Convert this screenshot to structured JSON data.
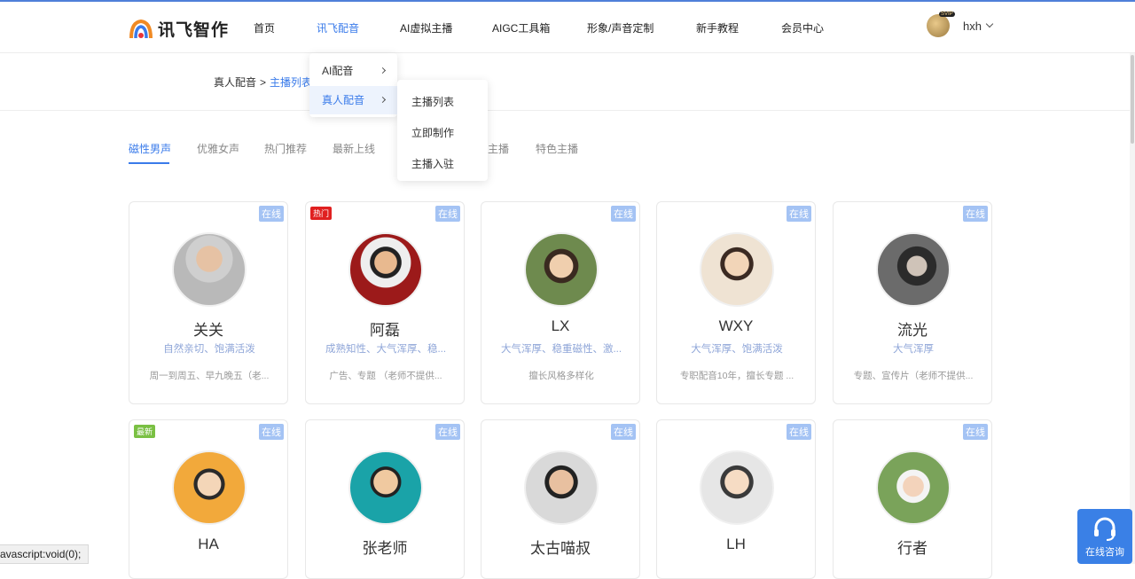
{
  "header": {
    "logo_text": "讯飞智作",
    "nav": [
      "首页",
      "讯飞配音",
      "AI虚拟主播",
      "AIGC工具箱",
      "形象/声音定制",
      "新手教程",
      "会员中心"
    ],
    "user": {
      "name": "hxh",
      "badge": "SVIP"
    }
  },
  "breadcrumb": {
    "root": "真人配音",
    "separator": ">",
    "current": "主播列表"
  },
  "dropdown": {
    "level1": [
      {
        "label": "AI配音"
      },
      {
        "label": "真人配音"
      }
    ],
    "level2": [
      "主播列表",
      "立即制作",
      "主播入驻"
    ]
  },
  "tabs": [
    "磁性男声",
    "优雅女声",
    "热门推荐",
    "最新上线",
    "主播",
    "特色主播"
  ],
  "cards": [
    {
      "name": "关关",
      "status": "在线",
      "desc": "自然亲切、饱满活泼",
      "note": "周一到周五、早九晚五（老..."
    },
    {
      "name": "阿磊",
      "status": "在线",
      "tag": "热门",
      "desc": "成熟知性、大气浑厚、稳...",
      "note": "广告、专题 （老师不提供..."
    },
    {
      "name": "LX",
      "status": "在线",
      "desc": "大气浑厚、稳重磁性、激...",
      "note": "擅长风格多样化"
    },
    {
      "name": "WXY",
      "status": "在线",
      "desc": "大气浑厚、饱满活泼",
      "note": "专职配音10年，擅长专题 ..."
    },
    {
      "name": "流光",
      "status": "在线",
      "desc": "大气浑厚",
      "note": "专题、宣传片（老师不提供..."
    },
    {
      "name": "HA",
      "status": "在线",
      "tag": "最新",
      "desc": "",
      "note": ""
    },
    {
      "name": "张老师",
      "status": "在线",
      "desc": "",
      "note": ""
    },
    {
      "name": "太古喵叔",
      "status": "在线",
      "desc": "",
      "note": ""
    },
    {
      "name": "LH",
      "status": "在线",
      "desc": "",
      "note": ""
    },
    {
      "name": "行者",
      "status": "在线",
      "desc": "",
      "note": ""
    }
  ],
  "status_bar": "avascript:void(0);",
  "consult_label": "在线咨询",
  "colors": {
    "accent": "#3a7bea",
    "online_badge": "#a4c3f4",
    "hot": "#e02020",
    "new": "#7ac043"
  }
}
